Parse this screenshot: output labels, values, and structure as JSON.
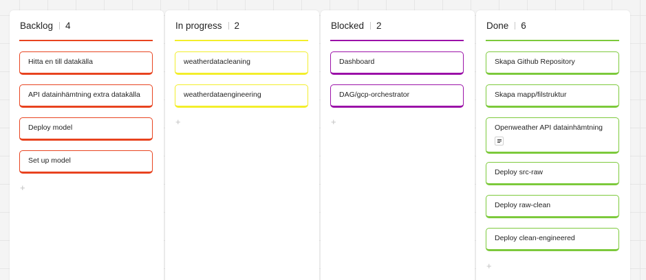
{
  "columns": [
    {
      "title": "Backlog",
      "count": "4",
      "color": "#e8431f",
      "cards": [
        {
          "label": "Hitta en till datakälla"
        },
        {
          "label": "API datainhämtning extra datakälla"
        },
        {
          "label": "Deploy model"
        },
        {
          "label": "Set up model"
        }
      ],
      "add_label": "+"
    },
    {
      "title": "In progress",
      "count": "2",
      "color": "#f3ee2a",
      "cards": [
        {
          "label": "weatherdatacleaning"
        },
        {
          "label": "weatherdataengineering"
        }
      ],
      "add_label": "+"
    },
    {
      "title": "Blocked",
      "count": "2",
      "color": "#9b10a8",
      "cards": [
        {
          "label": "Dashboard"
        },
        {
          "label": "DAG/gcp-orchestrator"
        }
      ],
      "add_label": "+"
    },
    {
      "title": "Done",
      "count": "6",
      "color": "#7cc93b",
      "cards": [
        {
          "label": "Skapa Github Repository"
        },
        {
          "label": "Skapa mapp/filstruktur"
        },
        {
          "label": "Openweather API datainhämtning",
          "icon": "description-icon"
        },
        {
          "label": "Deploy src-raw"
        },
        {
          "label": "Deploy raw-clean"
        },
        {
          "label": "Deploy clean-engineered"
        }
      ],
      "add_label": "+"
    }
  ]
}
